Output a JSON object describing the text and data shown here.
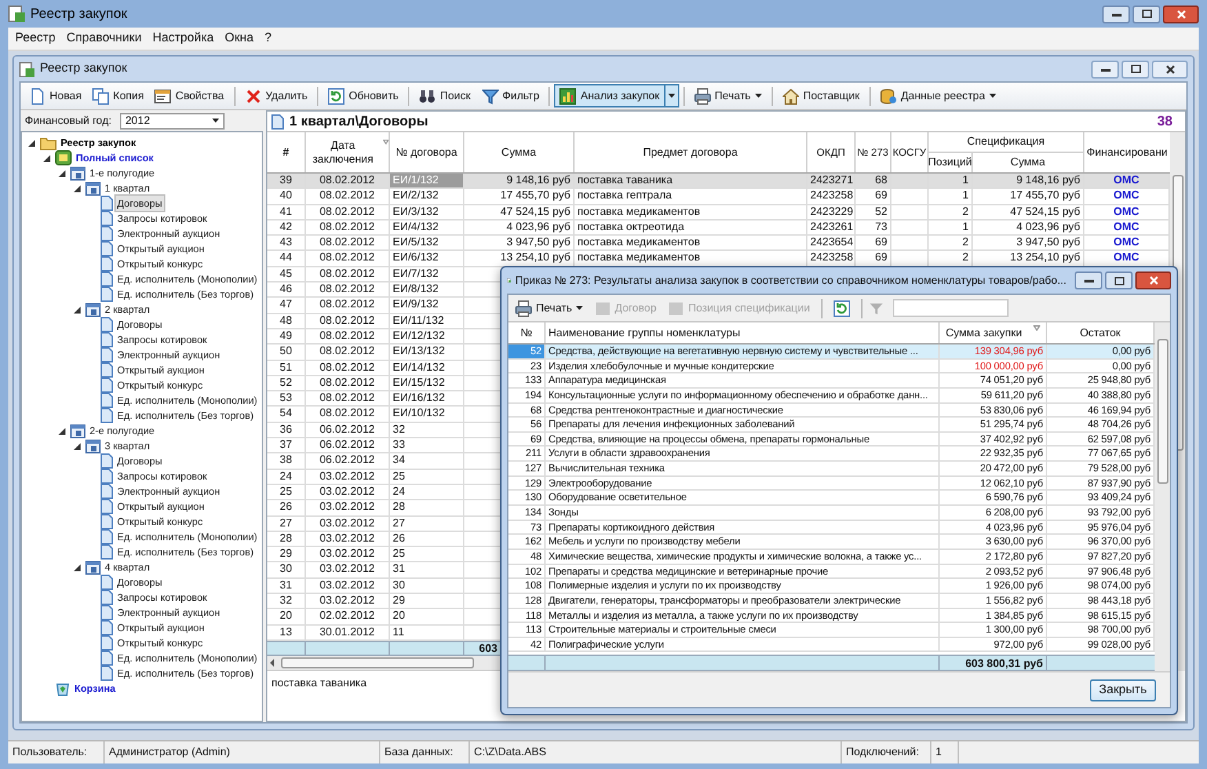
{
  "window": {
    "title": "Реестр закупок"
  },
  "menu": [
    "Реестр",
    "Справочники",
    "Настройка",
    "Окна",
    "?"
  ],
  "child_window": {
    "title": "Реестр закупок"
  },
  "toolbar": [
    [
      {
        "label": "Новая",
        "kind": "button",
        "pressed": false
      },
      {
        "label": "Копия",
        "kind": "button",
        "pressed": false
      },
      {
        "label": "Свойства",
        "kind": "button",
        "pressed": false
      }
    ],
    [
      {
        "label": "Удалить",
        "kind": "button",
        "pressed": false
      }
    ],
    [
      {
        "label": "Обновить",
        "kind": "button",
        "pressed": false
      }
    ],
    [
      {
        "label": "Поиск",
        "kind": "button",
        "pressed": false
      },
      {
        "label": "Фильтр",
        "kind": "button",
        "pressed": false
      }
    ],
    [
      {
        "label": "Анализ закупок",
        "kind": "split",
        "pressed": true
      }
    ],
    [
      {
        "label": "Печать",
        "kind": "dropdown",
        "pressed": false
      }
    ],
    [
      {
        "label": "Поставщик",
        "kind": "button",
        "pressed": false
      }
    ],
    [
      {
        "label": "Данные реестра",
        "kind": "dropdown",
        "pressed": false
      }
    ]
  ],
  "fin_year": {
    "label": "Финансовый год:",
    "value": "2012"
  },
  "tree": [
    {
      "label": "Реестр закупок",
      "kind": "root",
      "selected": false,
      "expanded": true,
      "children": [
        {
          "label": "Полный список",
          "kind": "list",
          "selected": false,
          "expanded": true,
          "children": [
            {
              "label": "1-е полугодие",
              "kind": "period",
              "selected": false,
              "expanded": true,
              "children": [
                {
                  "label": "1 квартал",
                  "kind": "period",
                  "selected": false,
                  "expanded": true,
                  "children": [
                    {
                      "label": "Договоры",
                      "kind": "doc",
                      "selected": true
                    },
                    {
                      "label": "Запросы котировок",
                      "kind": "doc",
                      "selected": false
                    },
                    {
                      "label": "Электронный аукцион",
                      "kind": "doc",
                      "selected": false
                    },
                    {
                      "label": "Открытый аукцион",
                      "kind": "doc",
                      "selected": false
                    },
                    {
                      "label": "Открытый конкурс",
                      "kind": "doc",
                      "selected": false
                    },
                    {
                      "label": "Ед. исполнитель (Монополии)",
                      "kind": "doc",
                      "selected": false
                    },
                    {
                      "label": "Ед. исполнитель (Без торгов)",
                      "kind": "doc",
                      "selected": false
                    }
                  ]
                },
                {
                  "label": "2 квартал",
                  "kind": "period",
                  "selected": false,
                  "expanded": true,
                  "children": [
                    {
                      "label": "Договоры",
                      "kind": "doc",
                      "selected": false
                    },
                    {
                      "label": "Запросы котировок",
                      "kind": "doc",
                      "selected": false
                    },
                    {
                      "label": "Электронный аукцион",
                      "kind": "doc",
                      "selected": false
                    },
                    {
                      "label": "Открытый аукцион",
                      "kind": "doc",
                      "selected": false
                    },
                    {
                      "label": "Открытый конкурс",
                      "kind": "doc",
                      "selected": false
                    },
                    {
                      "label": "Ед. исполнитель (Монополии)",
                      "kind": "doc",
                      "selected": false
                    },
                    {
                      "label": "Ед. исполнитель (Без торгов)",
                      "kind": "doc",
                      "selected": false
                    }
                  ]
                }
              ]
            },
            {
              "label": "2-е полугодие",
              "kind": "period",
              "selected": false,
              "expanded": true,
              "children": [
                {
                  "label": "3 квартал",
                  "kind": "period",
                  "selected": false,
                  "expanded": true,
                  "children": [
                    {
                      "label": "Договоры",
                      "kind": "doc",
                      "selected": false
                    },
                    {
                      "label": "Запросы котировок",
                      "kind": "doc",
                      "selected": false
                    },
                    {
                      "label": "Электронный аукцион",
                      "kind": "doc",
                      "selected": false
                    },
                    {
                      "label": "Открытый аукцион",
                      "kind": "doc",
                      "selected": false
                    },
                    {
                      "label": "Открытый конкурс",
                      "kind": "doc",
                      "selected": false
                    },
                    {
                      "label": "Ед. исполнитель (Монополии)",
                      "kind": "doc",
                      "selected": false
                    },
                    {
                      "label": "Ед. исполнитель (Без торгов)",
                      "kind": "doc",
                      "selected": false
                    }
                  ]
                },
                {
                  "label": "4 квартал",
                  "kind": "period",
                  "selected": false,
                  "expanded": true,
                  "children": [
                    {
                      "label": "Договоры",
                      "kind": "doc",
                      "selected": false
                    },
                    {
                      "label": "Запросы котировок",
                      "kind": "doc",
                      "selected": false
                    },
                    {
                      "label": "Электронный аукцион",
                      "kind": "doc",
                      "selected": false
                    },
                    {
                      "label": "Открытый аукцион",
                      "kind": "doc",
                      "selected": false
                    },
                    {
                      "label": "Открытый конкурс",
                      "kind": "doc",
                      "selected": false
                    },
                    {
                      "label": "Ед. исполнитель (Монополии)",
                      "kind": "doc",
                      "selected": false
                    },
                    {
                      "label": "Ед. исполнитель (Без торгов)",
                      "kind": "doc",
                      "selected": false
                    }
                  ]
                }
              ]
            }
          ]
        },
        {
          "label": "Корзина",
          "kind": "trash",
          "selected": false
        }
      ]
    }
  ],
  "content": {
    "path": "1 квартал\\Договоры",
    "count": "38"
  },
  "table": {
    "columns": [
      "#",
      "Дата заключения",
      "№ договора",
      "Сумма",
      "Предмет договора",
      "ОКДП",
      "№ 273",
      "КОСГУ"
    ],
    "group": {
      "label": "Спецификация",
      "columns": [
        "Позиций",
        "Сумма"
      ]
    },
    "last_column": "Финансировани",
    "rows": [
      {
        "selected": true,
        "num": "39",
        "date": "08.02.2012",
        "contract": "ЕИ/1/132",
        "sum": "9 148,16 руб",
        "subject": "поставка таваника",
        "okdp": "2423271",
        "n273": "68",
        "positions": "1",
        "spec_sum": "9 148,16 руб",
        "financing": "ОМС"
      },
      {
        "selected": false,
        "num": "40",
        "date": "08.02.2012",
        "contract": "ЕИ/2/132",
        "sum": "17 455,70 руб",
        "subject": "поставка гептрала",
        "okdp": "2423258",
        "n273": "69",
        "positions": "1",
        "spec_sum": "17 455,70 руб",
        "financing": "ОМС"
      },
      {
        "selected": false,
        "num": "41",
        "date": "08.02.2012",
        "contract": "ЕИ/3/132",
        "sum": "47 524,15 руб",
        "subject": "поставка медикаментов",
        "okdp": "2423229",
        "n273": "52",
        "positions": "2",
        "spec_sum": "47 524,15 руб",
        "financing": "ОМС"
      },
      {
        "selected": false,
        "num": "42",
        "date": "08.02.2012",
        "contract": "ЕИ/4/132",
        "sum": "4 023,96 руб",
        "subject": "поставка октреотида",
        "okdp": "2423261",
        "n273": "73",
        "positions": "1",
        "spec_sum": "4 023,96 руб",
        "financing": "ОМС"
      },
      {
        "selected": false,
        "num": "43",
        "date": "08.02.2012",
        "contract": "ЕИ/5/132",
        "sum": "3 947,50 руб",
        "subject": "поставка медикаментов",
        "okdp": "2423654",
        "n273": "69",
        "positions": "2",
        "spec_sum": "3 947,50 руб",
        "financing": "ОМС"
      },
      {
        "selected": false,
        "num": "44",
        "date": "08.02.2012",
        "contract": "ЕИ/6/132",
        "sum": "13 254,10 руб",
        "subject": "поставка медикаментов",
        "okdp": "2423258",
        "n273": "69",
        "positions": "2",
        "spec_sum": "13 254,10 руб",
        "financing": "ОМС"
      },
      {
        "selected": false,
        "num": "45",
        "date": "08.02.2012",
        "contract": "ЕИ/7/132"
      },
      {
        "selected": false,
        "num": "46",
        "date": "08.02.2012",
        "contract": "ЕИ/8/132"
      },
      {
        "selected": false,
        "num": "47",
        "date": "08.02.2012",
        "contract": "ЕИ/9/132"
      },
      {
        "selected": false,
        "num": "48",
        "date": "08.02.2012",
        "contract": "ЕИ/11/132"
      },
      {
        "selected": false,
        "num": "49",
        "date": "08.02.2012",
        "contract": "ЕИ/12/132"
      },
      {
        "selected": false,
        "num": "50",
        "date": "08.02.2012",
        "contract": "ЕИ/13/132"
      },
      {
        "selected": false,
        "num": "51",
        "date": "08.02.2012",
        "contract": "ЕИ/14/132"
      },
      {
        "selected": false,
        "num": "52",
        "date": "08.02.2012",
        "contract": "ЕИ/15/132"
      },
      {
        "selected": false,
        "num": "53",
        "date": "08.02.2012",
        "contract": "ЕИ/16/132"
      },
      {
        "selected": false,
        "num": "54",
        "date": "08.02.2012",
        "contract": "ЕИ/10/132"
      },
      {
        "selected": false,
        "num": "36",
        "date": "06.02.2012",
        "contract": "32"
      },
      {
        "selected": false,
        "num": "37",
        "date": "06.02.2012",
        "contract": "33"
      },
      {
        "selected": false,
        "num": "38",
        "date": "06.02.2012",
        "contract": "34"
      },
      {
        "selected": false,
        "num": "24",
        "date": "03.02.2012",
        "contract": "25"
      },
      {
        "selected": false,
        "num": "25",
        "date": "03.02.2012",
        "contract": "24"
      },
      {
        "selected": false,
        "num": "26",
        "date": "03.02.2012",
        "contract": "28"
      },
      {
        "selected": false,
        "num": "27",
        "date": "03.02.2012",
        "contract": "27"
      },
      {
        "selected": false,
        "num": "28",
        "date": "03.02.2012",
        "contract": "26"
      },
      {
        "selected": false,
        "num": "29",
        "date": "03.02.2012",
        "contract": "25"
      },
      {
        "selected": false,
        "num": "30",
        "date": "03.02.2012",
        "contract": "31"
      },
      {
        "selected": false,
        "num": "31",
        "date": "03.02.2012",
        "contract": "30"
      },
      {
        "selected": false,
        "num": "32",
        "date": "03.02.2012",
        "contract": "29"
      },
      {
        "selected": false,
        "num": "20",
        "date": "02.02.2012",
        "contract": "20"
      },
      {
        "selected": false,
        "num": "13",
        "date": "30.01.2012",
        "contract": "11"
      }
    ],
    "footer_sum": "603"
  },
  "memo": "поставка таваника",
  "dialog": {
    "title": "Приказ № 273: Результаты анализа закупок в соответствии со справочником номенклатуры товаров/рабо...",
    "toolbar": [
      {
        "label": "Печать",
        "kind": "dropdown",
        "disabled": false
      },
      {
        "label": "Договор",
        "kind": "button",
        "disabled": true
      },
      {
        "label": "Позиция спецификации",
        "kind": "button",
        "disabled": true
      }
    ],
    "columns": [
      "№",
      "Наименование группы номенклатуры",
      "Сумма закупки",
      "Остаток"
    ],
    "rows": [
      {
        "selected": true,
        "exceeded": true,
        "num": "52",
        "name": "Средства, действующие на вегетативную нервную систему и чувствительные ...",
        "sum": "139 304,96 руб",
        "rest": "0,00 руб"
      },
      {
        "selected": false,
        "exceeded": true,
        "num": "23",
        "name": "Изделия хлебобулочные и мучные кондитерские",
        "sum": "100 000,00 руб",
        "rest": "0,00 руб"
      },
      {
        "selected": false,
        "exceeded": false,
        "num": "133",
        "name": "Аппаратура медицинская",
        "sum": "74 051,20 руб",
        "rest": "25 948,80 руб"
      },
      {
        "selected": false,
        "exceeded": false,
        "num": "194",
        "name": "Консультационные услуги по информационному обеспечению и обработке данн...",
        "sum": "59 611,20 руб",
        "rest": "40 388,80 руб"
      },
      {
        "selected": false,
        "exceeded": false,
        "num": "68",
        "name": "Средства рентгеноконтрастные и диагностические",
        "sum": "53 830,06 руб",
        "rest": "46 169,94 руб"
      },
      {
        "selected": false,
        "exceeded": false,
        "num": "56",
        "name": "Препараты для лечения инфекционных заболеваний",
        "sum": "51 295,74 руб",
        "rest": "48 704,26 руб"
      },
      {
        "selected": false,
        "exceeded": false,
        "num": "69",
        "name": "Средства, влияющие на процессы обмена, препараты гормональные",
        "sum": "37 402,92 руб",
        "rest": "62 597,08 руб"
      },
      {
        "selected": false,
        "exceeded": false,
        "num": "211",
        "name": "Услуги в области здравоохранения",
        "sum": "22 932,35 руб",
        "rest": "77 067,65 руб"
      },
      {
        "selected": false,
        "exceeded": false,
        "num": "127",
        "name": "Вычислительная техника",
        "sum": "20 472,00 руб",
        "rest": "79 528,00 руб"
      },
      {
        "selected": false,
        "exceeded": false,
        "num": "129",
        "name": "Электрооборудование",
        "sum": "12 062,10 руб",
        "rest": "87 937,90 руб"
      },
      {
        "selected": false,
        "exceeded": false,
        "num": "130",
        "name": "Оборудование осветительное",
        "sum": "6 590,76 руб",
        "rest": "93 409,24 руб"
      },
      {
        "selected": false,
        "exceeded": false,
        "num": "134",
        "name": "Зонды",
        "sum": "6 208,00 руб",
        "rest": "93 792,00 руб"
      },
      {
        "selected": false,
        "exceeded": false,
        "num": "73",
        "name": "Препараты кортикоидного действия",
        "sum": "4 023,96 руб",
        "rest": "95 976,04 руб"
      },
      {
        "selected": false,
        "exceeded": false,
        "num": "162",
        "name": "Мебель и услуги по производству мебели",
        "sum": "3 630,00 руб",
        "rest": "96 370,00 руб"
      },
      {
        "selected": false,
        "exceeded": false,
        "num": "48",
        "name": "Химические вещества, химические продукты и химические волокна, а также ус...",
        "sum": "2 172,80 руб",
        "rest": "97 827,20 руб"
      },
      {
        "selected": false,
        "exceeded": false,
        "num": "102",
        "name": "Препараты и средства медицинские и ветеринарные прочие",
        "sum": "2 093,52 руб",
        "rest": "97 906,48 руб"
      },
      {
        "selected": false,
        "exceeded": false,
        "num": "108",
        "name": "Полимерные изделия и услуги по их производству",
        "sum": "1 926,00 руб",
        "rest": "98 074,00 руб"
      },
      {
        "selected": false,
        "exceeded": false,
        "num": "128",
        "name": "Двигатели, генераторы, трансформаторы и преобразователи электрические",
        "sum": "1 556,82 руб",
        "rest": "98 443,18 руб"
      },
      {
        "selected": false,
        "exceeded": false,
        "num": "118",
        "name": "Металлы и изделия из металла, а также услуги по их производству",
        "sum": "1 384,85 руб",
        "rest": "98 615,15 руб"
      },
      {
        "selected": false,
        "exceeded": false,
        "num": "113",
        "name": "Строительные материалы и строительные смеси",
        "sum": "1 300,00 руб",
        "rest": "98 700,00 руб"
      },
      {
        "selected": false,
        "exceeded": false,
        "num": "42",
        "name": "Полиграфические услуги",
        "sum": "972,00 руб",
        "rest": "99 028,00 руб"
      }
    ],
    "total": "603 800,31 руб",
    "close_button": "Закрыть"
  },
  "status_bar": [
    {
      "label": "Пользователь:",
      "value": "Администратор (Admin)"
    },
    {
      "label": "База данных:",
      "value": "C:\\Z\\Data.ABS"
    },
    {
      "label": "Подключений:",
      "value": "1"
    }
  ]
}
